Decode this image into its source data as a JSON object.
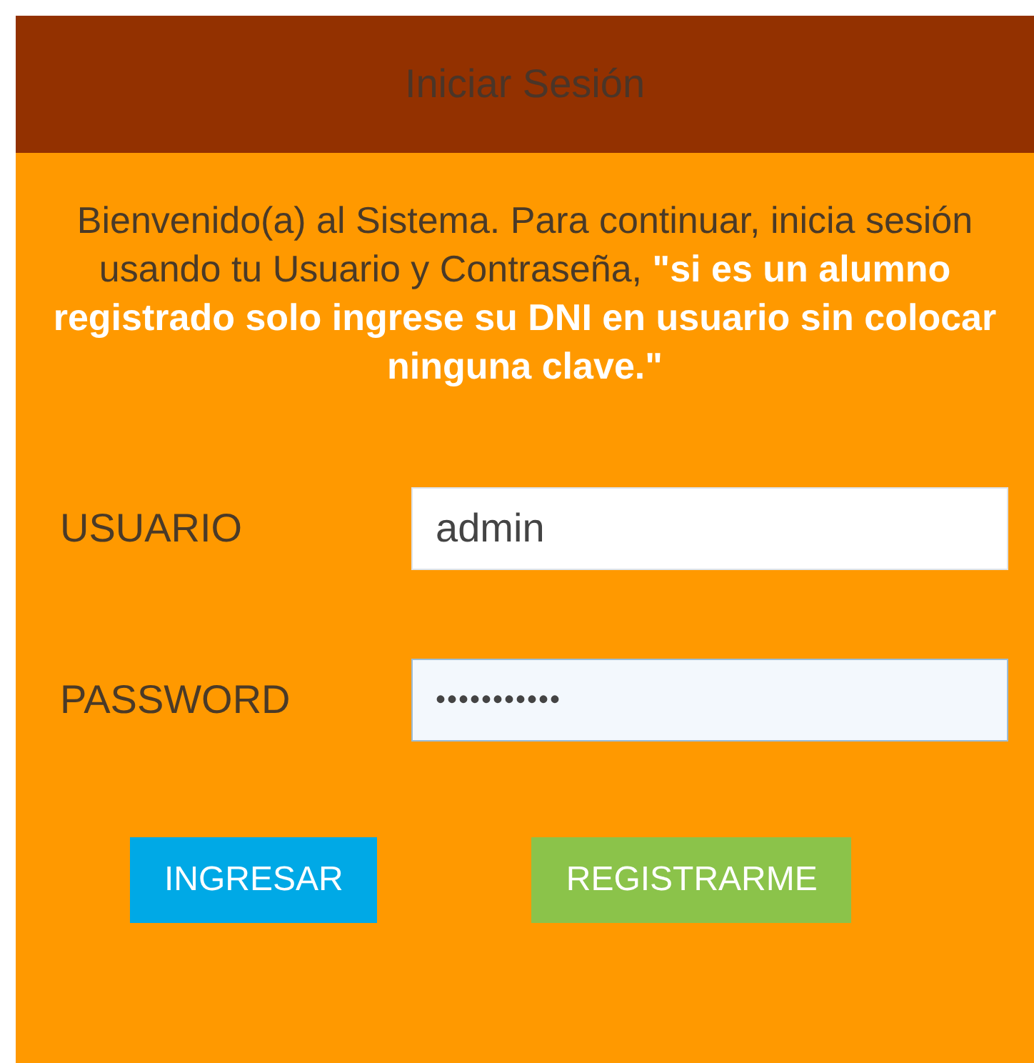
{
  "header": {
    "title": "Iniciar Sesión"
  },
  "intro": "Bienvenido(a) al Sistema. Para continuar, inicia sesión usando tu Usuario y Contraseña, **\"si es un alumno registrado solo ingrese su DNI en usuario sin colocar ninguna clave.\"**",
  "fields": [
    {
      "label": "USUARIO",
      "value": "admin",
      "focused": false
    },
    {
      "label": "PASSWORD",
      "value": "•••••••••••",
      "focused": true
    }
  ],
  "buttons": [
    {
      "label": "INGRESAR",
      "kind": "primary"
    },
    {
      "label": "REGISTRARME",
      "kind": "secondary"
    }
  ]
}
